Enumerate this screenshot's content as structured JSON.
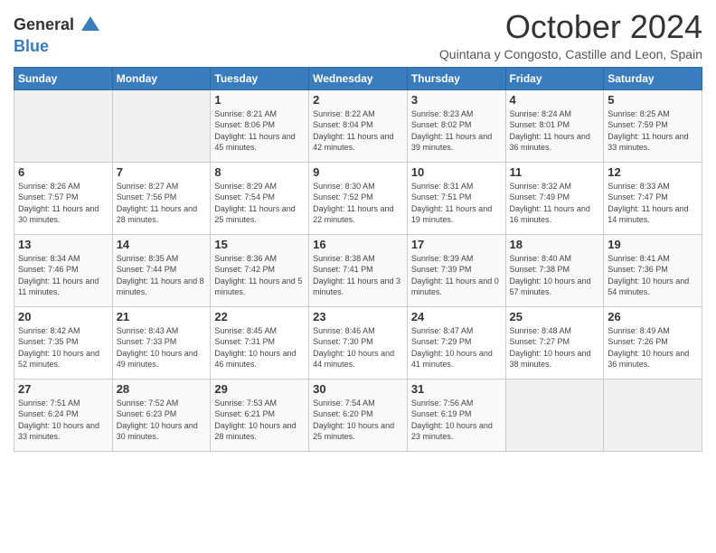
{
  "logo": {
    "line1": "General",
    "line2": "Blue"
  },
  "title": "October 2024",
  "subtitle": "Quintana y Congosto, Castille and Leon, Spain",
  "days_header": [
    "Sunday",
    "Monday",
    "Tuesday",
    "Wednesday",
    "Thursday",
    "Friday",
    "Saturday"
  ],
  "weeks": [
    [
      {
        "num": "",
        "info": ""
      },
      {
        "num": "",
        "info": ""
      },
      {
        "num": "1",
        "info": "Sunrise: 8:21 AM\nSunset: 8:06 PM\nDaylight: 11 hours and 45 minutes."
      },
      {
        "num": "2",
        "info": "Sunrise: 8:22 AM\nSunset: 8:04 PM\nDaylight: 11 hours and 42 minutes."
      },
      {
        "num": "3",
        "info": "Sunrise: 8:23 AM\nSunset: 8:02 PM\nDaylight: 11 hours and 39 minutes."
      },
      {
        "num": "4",
        "info": "Sunrise: 8:24 AM\nSunset: 8:01 PM\nDaylight: 11 hours and 36 minutes."
      },
      {
        "num": "5",
        "info": "Sunrise: 8:25 AM\nSunset: 7:59 PM\nDaylight: 11 hours and 33 minutes."
      }
    ],
    [
      {
        "num": "6",
        "info": "Sunrise: 8:26 AM\nSunset: 7:57 PM\nDaylight: 11 hours and 30 minutes."
      },
      {
        "num": "7",
        "info": "Sunrise: 8:27 AM\nSunset: 7:56 PM\nDaylight: 11 hours and 28 minutes."
      },
      {
        "num": "8",
        "info": "Sunrise: 8:29 AM\nSunset: 7:54 PM\nDaylight: 11 hours and 25 minutes."
      },
      {
        "num": "9",
        "info": "Sunrise: 8:30 AM\nSunset: 7:52 PM\nDaylight: 11 hours and 22 minutes."
      },
      {
        "num": "10",
        "info": "Sunrise: 8:31 AM\nSunset: 7:51 PM\nDaylight: 11 hours and 19 minutes."
      },
      {
        "num": "11",
        "info": "Sunrise: 8:32 AM\nSunset: 7:49 PM\nDaylight: 11 hours and 16 minutes."
      },
      {
        "num": "12",
        "info": "Sunrise: 8:33 AM\nSunset: 7:47 PM\nDaylight: 11 hours and 14 minutes."
      }
    ],
    [
      {
        "num": "13",
        "info": "Sunrise: 8:34 AM\nSunset: 7:46 PM\nDaylight: 11 hours and 11 minutes."
      },
      {
        "num": "14",
        "info": "Sunrise: 8:35 AM\nSunset: 7:44 PM\nDaylight: 11 hours and 8 minutes."
      },
      {
        "num": "15",
        "info": "Sunrise: 8:36 AM\nSunset: 7:42 PM\nDaylight: 11 hours and 5 minutes."
      },
      {
        "num": "16",
        "info": "Sunrise: 8:38 AM\nSunset: 7:41 PM\nDaylight: 11 hours and 3 minutes."
      },
      {
        "num": "17",
        "info": "Sunrise: 8:39 AM\nSunset: 7:39 PM\nDaylight: 11 hours and 0 minutes."
      },
      {
        "num": "18",
        "info": "Sunrise: 8:40 AM\nSunset: 7:38 PM\nDaylight: 10 hours and 57 minutes."
      },
      {
        "num": "19",
        "info": "Sunrise: 8:41 AM\nSunset: 7:36 PM\nDaylight: 10 hours and 54 minutes."
      }
    ],
    [
      {
        "num": "20",
        "info": "Sunrise: 8:42 AM\nSunset: 7:35 PM\nDaylight: 10 hours and 52 minutes."
      },
      {
        "num": "21",
        "info": "Sunrise: 8:43 AM\nSunset: 7:33 PM\nDaylight: 10 hours and 49 minutes."
      },
      {
        "num": "22",
        "info": "Sunrise: 8:45 AM\nSunset: 7:31 PM\nDaylight: 10 hours and 46 minutes."
      },
      {
        "num": "23",
        "info": "Sunrise: 8:46 AM\nSunset: 7:30 PM\nDaylight: 10 hours and 44 minutes."
      },
      {
        "num": "24",
        "info": "Sunrise: 8:47 AM\nSunset: 7:29 PM\nDaylight: 10 hours and 41 minutes."
      },
      {
        "num": "25",
        "info": "Sunrise: 8:48 AM\nSunset: 7:27 PM\nDaylight: 10 hours and 38 minutes."
      },
      {
        "num": "26",
        "info": "Sunrise: 8:49 AM\nSunset: 7:26 PM\nDaylight: 10 hours and 36 minutes."
      }
    ],
    [
      {
        "num": "27",
        "info": "Sunrise: 7:51 AM\nSunset: 6:24 PM\nDaylight: 10 hours and 33 minutes."
      },
      {
        "num": "28",
        "info": "Sunrise: 7:52 AM\nSunset: 6:23 PM\nDaylight: 10 hours and 30 minutes."
      },
      {
        "num": "29",
        "info": "Sunrise: 7:53 AM\nSunset: 6:21 PM\nDaylight: 10 hours and 28 minutes."
      },
      {
        "num": "30",
        "info": "Sunrise: 7:54 AM\nSunset: 6:20 PM\nDaylight: 10 hours and 25 minutes."
      },
      {
        "num": "31",
        "info": "Sunrise: 7:56 AM\nSunset: 6:19 PM\nDaylight: 10 hours and 23 minutes."
      },
      {
        "num": "",
        "info": ""
      },
      {
        "num": "",
        "info": ""
      }
    ]
  ]
}
